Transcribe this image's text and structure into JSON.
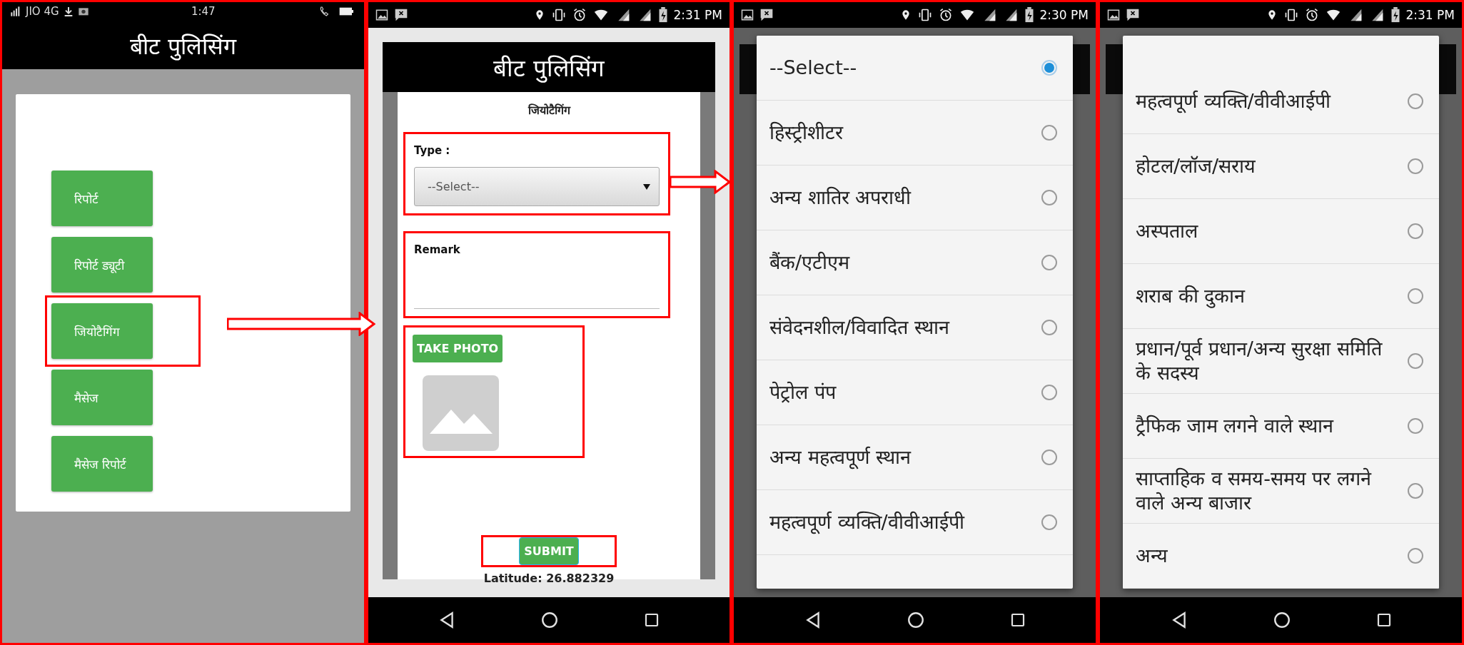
{
  "panels": [
    {
      "kind": "menu",
      "status_bar": {
        "carrier": "JIO 4G",
        "time": "1:47"
      },
      "title": "बीट पुलिसिंग",
      "menu_items": [
        {
          "label": "रिपोर्ट",
          "highlighted": false
        },
        {
          "label": "रिपोर्ट ड्यूटी",
          "highlighted": false
        },
        {
          "label": "जियोटैगिंग",
          "highlighted": true
        },
        {
          "label": "मैसेज",
          "highlighted": false
        },
        {
          "label": "मैसेज रिपोर्ट",
          "highlighted": false
        }
      ]
    },
    {
      "kind": "form",
      "status_bar": {
        "time": "2:31 PM"
      },
      "title": "बीट पुलिसिंग",
      "form_title": "जियोटैगिंग",
      "type_field": {
        "label": "Type :",
        "value": "--Select--",
        "highlighted": true
      },
      "remark_field": {
        "label": "Remark",
        "highlighted": true
      },
      "photo": {
        "button": "TAKE PHOTO",
        "highlighted": true
      },
      "submit": {
        "label": "SUBMIT",
        "highlighted": true
      },
      "latitude": "Latitude: 26.882329"
    },
    {
      "kind": "picker",
      "status_bar": {
        "time": "2:30 PM"
      },
      "scrolled_to_end": false,
      "options": [
        {
          "label": "--Select--",
          "selected": true
        },
        {
          "label": "हिस्ट्रीशीटर",
          "selected": false
        },
        {
          "label": "अन्य शातिर अपराधी",
          "selected": false
        },
        {
          "label": "बैंक/एटीएम",
          "selected": false
        },
        {
          "label": "संवेदनशील/विवादित स्थान",
          "selected": false
        },
        {
          "label": "पेट्रोल पंप",
          "selected": false
        },
        {
          "label": "अन्य महत्वपूर्ण स्थान",
          "selected": false
        },
        {
          "label": "महत्वपूर्ण व्यक्ति/वीवीआईपी",
          "selected": false
        }
      ]
    },
    {
      "kind": "picker",
      "status_bar": {
        "time": "2:31 PM"
      },
      "scrolled_to_end": true,
      "options": [
        {
          "label": "महत्वपूर्ण व्यक्ति/वीवीआईपी",
          "selected": false
        },
        {
          "label": "होटल/लॉज/सराय",
          "selected": false
        },
        {
          "label": "अस्पताल",
          "selected": false
        },
        {
          "label": "शराब की दुकान",
          "selected": false
        },
        {
          "label": "प्रधान/पूर्व प्रधान/अन्य सुरक्षा समिति के सदस्य",
          "selected": false
        },
        {
          "label": "ट्रैफिक जाम लगने वाले स्थान",
          "selected": false
        },
        {
          "label": "साप्ताहिक व समय-समय पर लगने वाले अन्य बाजार",
          "selected": false
        },
        {
          "label": "अन्य",
          "selected": false
        }
      ]
    }
  ]
}
